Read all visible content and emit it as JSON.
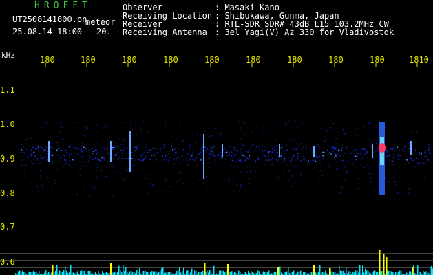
{
  "header": {
    "title": "HROFFT",
    "filename": "UT2508141800.pn",
    "mode": "meteor",
    "datetime": "25.08.14 18:00",
    "duration": "20.",
    "fields": [
      {
        "label": "Observer",
        "value": ": Masaki Kano"
      },
      {
        "label": "Receiving Location",
        "value": ": Shibukawa, Gunma, Japan"
      },
      {
        "label": "Receiver",
        "value": ": RTL-SDR SDR# 43dB L15 103.2MHz CW"
      },
      {
        "label": "Receiving Antenna",
        "value": ": 3el Yagi(V) Az 330 for Vladivostok"
      }
    ]
  },
  "axis": {
    "unit": "kHz",
    "time_ticks": [
      "180",
      "180",
      "180",
      "180",
      "180",
      "180",
      "180",
      "180",
      "180",
      "1810"
    ],
    "freq_ticks": [
      "1.1",
      "1.0",
      "0.9",
      "0.8",
      "0.7",
      "0.6"
    ]
  },
  "colors": {
    "background": "#000000",
    "label_green": "#3ec43e",
    "tick_yellow": "#e6e600",
    "signal_blue": "#1a2bd6",
    "signal_hot": "#ff3a6a",
    "count_cyan": "#00e5ff",
    "count_yellow": "#ffff00"
  }
}
